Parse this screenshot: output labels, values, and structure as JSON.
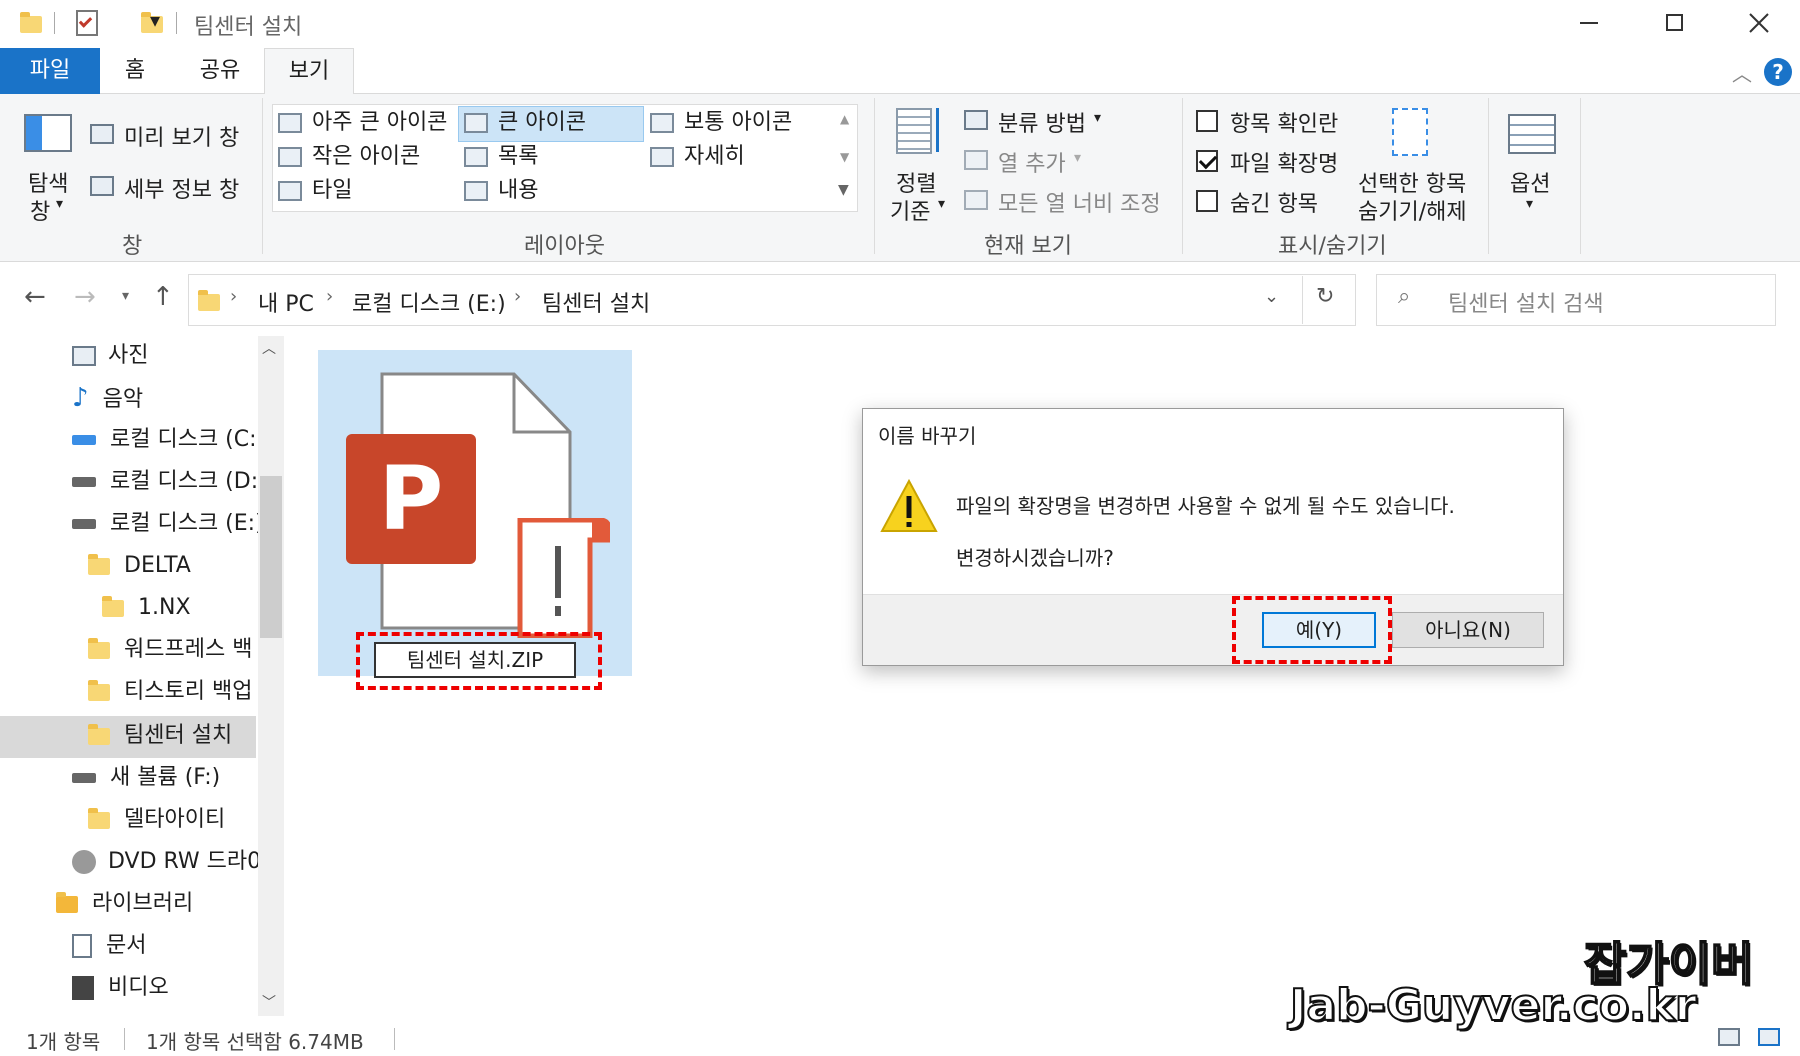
{
  "title_bar": {
    "title": "팀센터 설치",
    "qat_dropdown": "▾"
  },
  "ribbon_tabs": [
    {
      "label": "파일"
    },
    {
      "label": "홈"
    },
    {
      "label": "공유"
    },
    {
      "label": "보기"
    }
  ],
  "ribbon": {
    "pane": {
      "nav_pane_line1": "탐색",
      "nav_pane_line2": "창",
      "preview_pane": "미리 보기 창",
      "details_pane": "세부 정보 창",
      "group_label": "창"
    },
    "layout": {
      "items": [
        "아주 큰 아이콘",
        "큰 아이콘",
        "보통 아이콘",
        "작은 아이콘",
        "목록",
        "자세히",
        "타일",
        "내용"
      ],
      "group_label": "레이아웃"
    },
    "current_view": {
      "sort_line1": "정렬",
      "sort_line2": "기준",
      "group_by": "분류 방법",
      "add_columns": "열 추가",
      "fit_columns": "모든 열 너비 조정",
      "group_label": "현재 보기"
    },
    "show_hide": {
      "item_checkboxes": "항목 확인란",
      "item_checkboxes_checked": false,
      "file_extensions": "파일 확장명",
      "file_extensions_checked": true,
      "hidden_items": "숨긴 항목",
      "hidden_items_checked": false,
      "hide_selected_line1": "선택한 항목",
      "hide_selected_line2": "숨기기/해제",
      "group_label": "표시/숨기기"
    },
    "options": {
      "label": "옵션"
    }
  },
  "address_bar": {
    "crumbs": [
      "내 PC",
      "로컬 디스크 (E:)",
      "팀센터 설치"
    ],
    "search_placeholder": "팀센터 설치 검색"
  },
  "nav_pane": {
    "items": [
      {
        "label": "사진",
        "icon": "pictures-icon"
      },
      {
        "label": "음악",
        "icon": "music-icon"
      },
      {
        "label": "로컬 디스크 (C:",
        "icon": "drive-icon"
      },
      {
        "label": "로컬 디스크 (D:",
        "icon": "drive-icon"
      },
      {
        "label": "로컬 디스크 (E:)",
        "icon": "drive-icon"
      },
      {
        "label": "DELTA",
        "icon": "folder-icon"
      },
      {
        "label": "1.NX",
        "icon": "folder-icon"
      },
      {
        "label": "워드프레스 백",
        "icon": "folder-icon"
      },
      {
        "label": "티스토리 백업",
        "icon": "folder-icon"
      },
      {
        "label": "팀센터 설치",
        "icon": "folder-icon"
      },
      {
        "label": "새 볼륨 (F:)",
        "icon": "drive-icon"
      },
      {
        "label": "델타아이티",
        "icon": "folder-icon"
      },
      {
        "label": "DVD RW 드라0",
        "icon": "dvd-icon"
      },
      {
        "label": "라이브러리",
        "icon": "library-icon"
      },
      {
        "label": "문서",
        "icon": "document-icon"
      },
      {
        "label": "비디오",
        "icon": "video-icon"
      }
    ]
  },
  "file": {
    "rename_value": "팀센터 설치.ZIP",
    "badge_letter": "P"
  },
  "dialog": {
    "title": "이름 바꾸기",
    "message": "파일의 확장명을 변경하면 사용할 수 없게 될 수도 있습니다.",
    "question": "변경하시겠습니까?",
    "yes": "예(Y)",
    "no": "아니요(N)"
  },
  "status_bar": {
    "count": "1개 항목",
    "selection": "1개 항목 선택함 6.74MB"
  },
  "watermark": {
    "line1": "잡가이버",
    "line2": "Jab-Guyver.co.kr"
  },
  "colors": {
    "accent": "#1a73c8",
    "ppt_red": "#c8462a",
    "selection": "#cce4f7",
    "dashed": "#e00000"
  }
}
